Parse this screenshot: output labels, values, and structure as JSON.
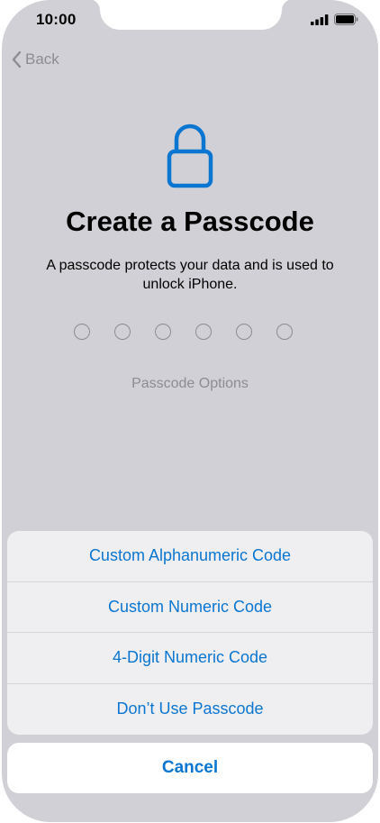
{
  "status_bar": {
    "time": "10:00",
    "signal_icon": "cellular-signal-icon",
    "battery_icon": "battery-icon"
  },
  "nav": {
    "back_label": "Back",
    "back_icon": "chevron-left-icon"
  },
  "main": {
    "lock_icon": "lock-icon",
    "title": "Create a Passcode",
    "subtitle": "A passcode protects your data and is used to unlock iPhone.",
    "passcode_length": 6,
    "options_link": "Passcode Options"
  },
  "action_sheet": {
    "items": [
      {
        "label": "Custom Alphanumeric Code"
      },
      {
        "label": "Custom Numeric Code"
      },
      {
        "label": "4-Digit Numeric Code"
      },
      {
        "label": "Don’t Use Passcode"
      }
    ],
    "cancel_label": "Cancel"
  },
  "colors": {
    "accent": "#0b76d1",
    "background": "#d1d0d6",
    "muted_text": "#8d8c92"
  }
}
